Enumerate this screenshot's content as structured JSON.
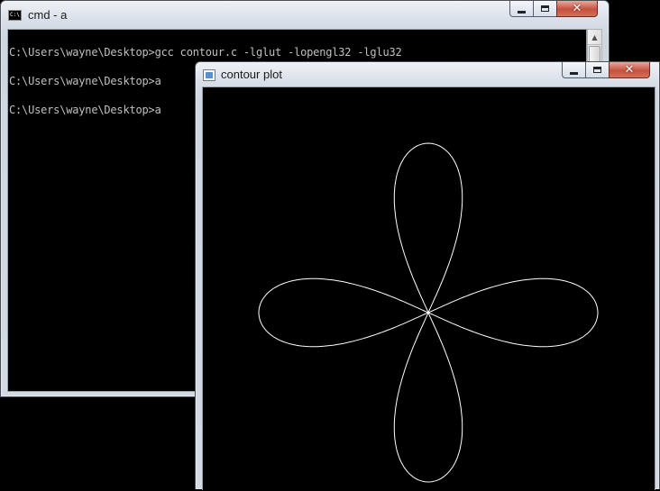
{
  "cmd_window": {
    "title": "cmd - a",
    "icon": "console-icon",
    "icon_text": "C:\\.",
    "lines": [
      "C:\\Users\\wayne\\Desktop>gcc contour.c -lglut -lopengl32 -lglu32",
      "C:\\Users\\wayne\\Desktop>a",
      "C:\\Users\\wayne\\Desktop>a"
    ]
  },
  "plot_window": {
    "title": "contour plot",
    "icon": "opengl-window-icon",
    "curve": {
      "type": "four-petal rose contour",
      "color": "#ffffff",
      "background": "#000000"
    }
  },
  "caption_buttons": {
    "close_glyph": "✕"
  },
  "colors": {
    "console_text": "#c0c0c0",
    "close_button": "#c7503c"
  }
}
